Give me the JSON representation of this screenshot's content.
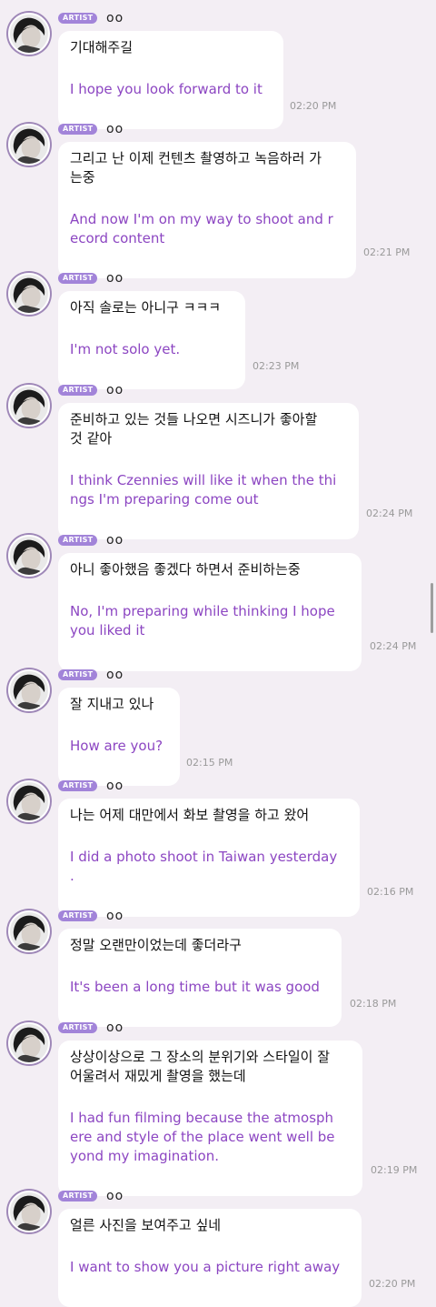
{
  "badge_label": "ARTIST",
  "artist_name": "oo",
  "accent_color": "#8c46c2",
  "badge_color": "#a284d9",
  "messages": [
    {
      "korean": "기대해주길",
      "english": "I hope you look forward to it",
      "time": "02:20 PM"
    },
    {
      "korean": "그리고 난 이제 컨텐츠 촬영하고 녹음하러 가\n는중",
      "english": "And now I'm on my way to shoot and r\necord content",
      "time": "02:21 PM"
    },
    {
      "korean": "아직 솔로는 아니구 ㅋㅋㅋ",
      "english": "I'm not solo yet.",
      "time": "02:23 PM"
    },
    {
      "korean": "준비하고 있는 것들 나오면 시즈니가 좋아할\n것 같아",
      "english": "I think Czennies will like it when the thi\nngs I'm preparing come out",
      "time": "02:24 PM"
    },
    {
      "korean": "아니 좋아했음 좋겠다 하면서 준비하는중",
      "english": "No, I'm preparing while thinking I hope\nyou liked it",
      "time": "02:24 PM"
    },
    {
      "korean": "잘 지내고 있나",
      "english": "How are you?",
      "time": "02:15 PM"
    },
    {
      "korean": "나는 어제 대만에서 화보 촬영을 하고 왔어",
      "english": "I did a photo shoot in Taiwan yesterday\n.",
      "time": "02:16 PM"
    },
    {
      "korean": "정말 오랜만이었는데 좋더라구",
      "english": "It's been a long time but it was good",
      "time": "02:18 PM"
    },
    {
      "korean": "상상이상으로 그 장소의 분위기와 스타일이 잘\n어울려서 재밌게 촬영을 했는데",
      "english": "I had fun filming because the atmosph\nere and style of the place went well be\nyond my imagination.",
      "time": "02:19 PM"
    },
    {
      "korean": "얼른 사진을 보여주고 싶네",
      "english": "I want to show you a picture right away",
      "time": "02:20 PM"
    }
  ]
}
